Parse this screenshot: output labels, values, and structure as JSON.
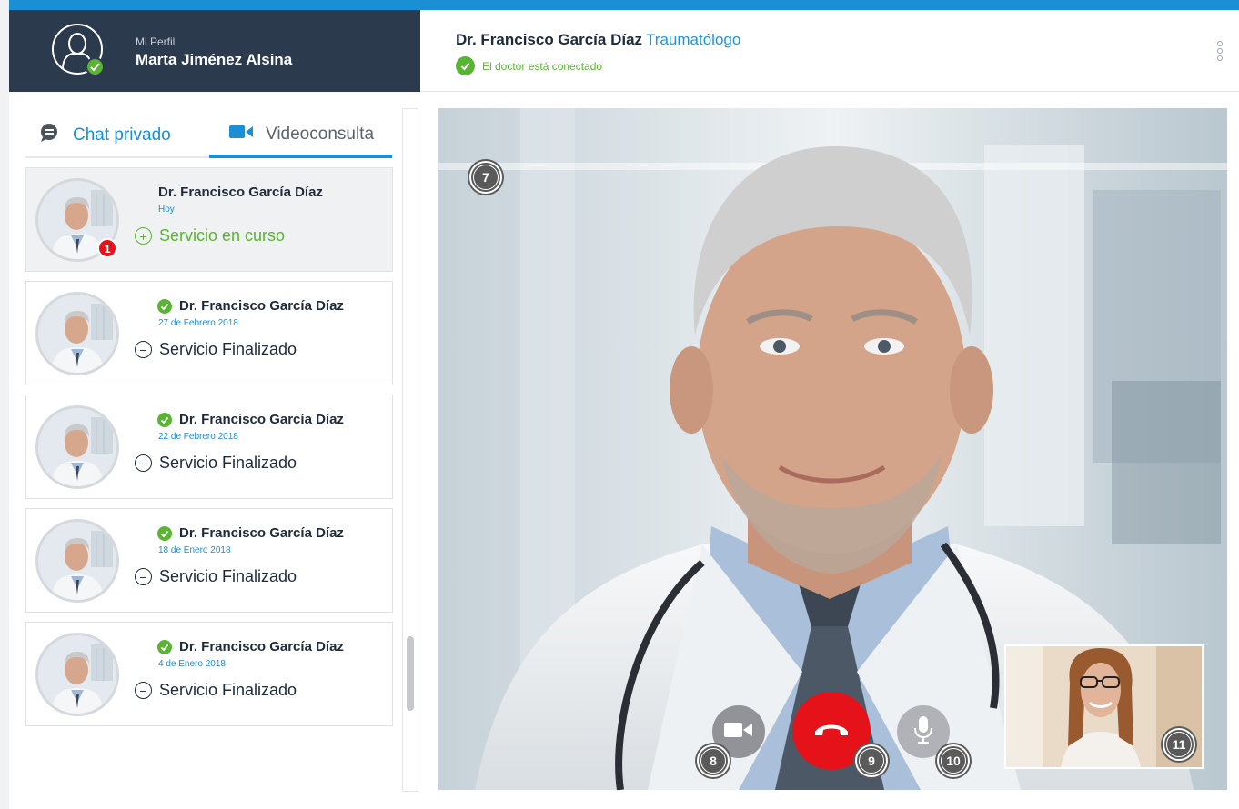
{
  "colors": {
    "accent": "#1a8fd4",
    "profile_bg": "#2b3a4c",
    "online_green": "#5ab433",
    "hangup_red": "#e5121a"
  },
  "profile": {
    "subtitle": "Mi Perfil",
    "name": "Marta Jiménez Alsina",
    "avatar_icon": "user-avatar-icon",
    "status_icon": "online-check-icon"
  },
  "header": {
    "doctor_name": "Dr. Francisco García Díaz",
    "specialty": "Traumatólogo",
    "connection_status": "El doctor está conectado",
    "menu_icon": "more-vertical-icon"
  },
  "tabs": [
    {
      "label": "Chat privado",
      "icon": "chat-bubble-icon",
      "active": false
    },
    {
      "label": "Videoconsulta",
      "icon": "video-camera-icon",
      "active": true
    }
  ],
  "consultations": [
    {
      "doctor": "Dr. Francisco García Díaz",
      "date": "Hoy",
      "status": "Servicio en curso",
      "state": "in-progress",
      "unread": "1"
    },
    {
      "doctor": "Dr. Francisco García Díaz",
      "date": "27 de Febrero 2018",
      "status": "Servicio Finalizado",
      "state": "finished"
    },
    {
      "doctor": "Dr. Francisco García Díaz",
      "date": "22 de Febrero 2018",
      "status": "Servicio Finalizado",
      "state": "finished"
    },
    {
      "doctor": "Dr. Francisco García Díaz",
      "date": "18 de Enero 2018",
      "status": "Servicio Finalizado",
      "state": "finished"
    },
    {
      "doctor": "Dr. Francisco García Díaz",
      "date": "4 de Enero 2018",
      "status": "Servicio Finalizado",
      "state": "finished"
    }
  ],
  "video_call": {
    "markers": {
      "video": "7",
      "camera": "8",
      "hangup": "9",
      "microphone": "10",
      "self_view": "11"
    },
    "controls": [
      {
        "name": "camera-toggle",
        "icon": "video-camera-icon"
      },
      {
        "name": "hangup",
        "icon": "phone-hangup-icon"
      },
      {
        "name": "microphone-toggle",
        "icon": "microphone-icon"
      }
    ]
  }
}
